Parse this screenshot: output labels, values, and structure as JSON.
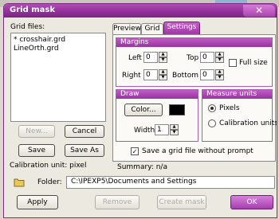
{
  "window": {
    "title": "Grid mask",
    "close_glyph": "✕"
  },
  "files": {
    "label": "Grid files:",
    "items": [
      "* crosshair.grd",
      "LineOrth.grd"
    ]
  },
  "buttons": {
    "new": "New...",
    "cancel": "Cancel",
    "save": "Save",
    "save_as": "Save As",
    "apply": "Apply",
    "remove": "Remove",
    "create_mask": "Create mask",
    "ok": "OK"
  },
  "info": {
    "calibration_unit": "Calibration unit: pixel",
    "summary": "Summary: n/a"
  },
  "folder": {
    "label": "Folder:",
    "path": "C:\\IPEXP5\\Documents and Settings"
  },
  "tabs": {
    "preview": "Preview",
    "grid": "Grid",
    "settings": "Settings"
  },
  "margins": {
    "header": "Margins",
    "left_label": "Left",
    "left_value": "0",
    "top_label": "Top",
    "top_value": "0",
    "right_label": "Right",
    "right_value": "0",
    "bottom_label": "Bottom",
    "bottom_value": "0",
    "full_size_label": "Full size"
  },
  "draw": {
    "header": "Draw",
    "color_button": "Color...",
    "color_value": "#000000",
    "width_label": "Width",
    "width_value": "1"
  },
  "units": {
    "header": "Measure units",
    "pixels": "Pixels",
    "calibration": "Calibration units",
    "selected": "Pixels"
  },
  "save_without_prompt": {
    "label": "Save a grid file without prompt",
    "checked": true
  },
  "colors": {
    "accent": "#9b3aa3",
    "title_bar": "#8f2f98"
  }
}
